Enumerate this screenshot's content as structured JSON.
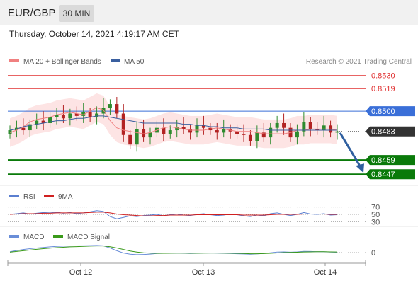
{
  "header": {
    "pair": "EUR/GBP",
    "timeframe": "30 MIN"
  },
  "datetime": "Thursday, October 14, 2021 4:19:17 AM CET",
  "legend": {
    "ma20": "MA 20 + Bollinger Bands",
    "ma50": "MA 50",
    "credit": "Research © 2021 Trading Central"
  },
  "colors": {
    "ma20": "#f08080",
    "ma50": "#3a5f9f",
    "bull": "#2e8b2e",
    "bear": "#b22222",
    "support": "#0a7a0a",
    "resistance": "#e03030",
    "pivot": "#3a6fd8",
    "current": "#333333",
    "arrow": "#2f5f9f",
    "band": "#fde4e4",
    "rsi": "#5b7fd0",
    "rsi9": "#d02020",
    "macd": "#6a8ed8",
    "macd_signal": "#3a9a1a"
  },
  "chart_data": [
    {
      "type": "line",
      "title": "EUR/GBP",
      "ylim": [
        0.844,
        0.8534
      ],
      "x_ticks": [
        "Oct 12",
        "Oct 13",
        "Oct 14"
      ],
      "levels": [
        {
          "label": "0.8530",
          "value": 0.853,
          "kind": "resistance"
        },
        {
          "label": "0.8519",
          "value": 0.8519,
          "kind": "resistance"
        },
        {
          "label": "0.8500",
          "value": 0.85,
          "kind": "pivot"
        },
        {
          "label": "0.8483",
          "value": 0.8483,
          "kind": "current"
        },
        {
          "label": "0.8459",
          "value": 0.8459,
          "kind": "support"
        },
        {
          "label": "0.8447",
          "value": 0.8447,
          "kind": "support"
        }
      ],
      "series": [
        {
          "name": "MA 20 + Bollinger Bands",
          "values": [
            0.8482,
            0.8484,
            0.8487,
            0.8491,
            0.8493,
            0.8494,
            0.8495,
            0.8497,
            0.8498,
            0.8499,
            0.8498,
            0.8497,
            0.85,
            0.8503,
            0.8501,
            0.8492,
            0.8486,
            0.8484,
            0.8483,
            0.8482,
            0.8481,
            0.8482,
            0.8484,
            0.8486,
            0.8487,
            0.8486,
            0.8485,
            0.8484,
            0.8484,
            0.8484,
            0.8485,
            0.8486,
            0.8485,
            0.8484,
            0.8483,
            0.8483,
            0.8483,
            0.8482,
            0.8481,
            0.8481,
            0.8481,
            0.8481,
            0.8482,
            0.8484,
            0.8484,
            0.8485,
            0.8485,
            0.8485,
            0.8485,
            0.8484
          ]
        },
        {
          "name": "MA 50",
          "values": [
            0.8484,
            0.8485,
            0.8487,
            0.8488,
            0.8489,
            0.849,
            0.8491,
            0.8492,
            0.8492,
            0.8493,
            0.8494,
            0.8494,
            0.8495,
            0.8496,
            0.8496,
            0.8495,
            0.8494,
            0.8493,
            0.8492,
            0.8491,
            0.849,
            0.849,
            0.849,
            0.849,
            0.849,
            0.849,
            0.8489,
            0.8489,
            0.8488,
            0.8488,
            0.8487,
            0.8487,
            0.8486,
            0.8486,
            0.8486,
            0.8485,
            0.8485,
            0.8485,
            0.8485,
            0.8484,
            0.8484,
            0.8484,
            0.8484,
            0.8484,
            0.8484,
            0.8484,
            0.8484,
            0.8484,
            0.8484,
            0.8484
          ]
        }
      ],
      "candles_close": [
        0.8484,
        0.8486,
        0.8484,
        0.8489,
        0.8492,
        0.849,
        0.8495,
        0.8497,
        0.8494,
        0.8498,
        0.8496,
        0.8499,
        0.8495,
        0.8498,
        0.8503,
        0.8506,
        0.8498,
        0.848,
        0.8472,
        0.8485,
        0.8478,
        0.8482,
        0.8486,
        0.8481,
        0.8484,
        0.8487,
        0.8485,
        0.8482,
        0.8488,
        0.8486,
        0.8484,
        0.8482,
        0.8485,
        0.8483,
        0.8481,
        0.848,
        0.8475,
        0.8482,
        0.8478,
        0.8486,
        0.849,
        0.8486,
        0.8478,
        0.8483,
        0.8491,
        0.8485,
        0.8484,
        0.8488,
        0.8482,
        0.8483
      ],
      "forecast_arrow": {
        "from": 0.8483,
        "to": 0.8447
      }
    },
    {
      "type": "line",
      "title": "RSI",
      "ylim": [
        25,
        75
      ],
      "y_ticks": [
        "70",
        "50",
        "30"
      ],
      "series": [
        {
          "name": "RSI",
          "values": [
            50,
            52,
            54,
            51,
            53,
            55,
            54,
            56,
            53,
            55,
            52,
            54,
            57,
            60,
            58,
            44,
            38,
            42,
            46,
            44,
            47,
            48,
            50,
            46,
            49,
            51,
            48,
            47,
            50,
            52,
            49,
            47,
            48,
            51,
            49,
            46,
            44,
            48,
            46,
            52,
            54,
            50,
            47,
            50,
            55,
            51,
            50,
            52,
            48,
            49
          ]
        },
        {
          "name": "9MA",
          "values": [
            50,
            51,
            52,
            52,
            52,
            53,
            53,
            54,
            54,
            54,
            54,
            54,
            55,
            56,
            56,
            54,
            51,
            49,
            48,
            47,
            46,
            46,
            47,
            47,
            48,
            48,
            48,
            48,
            49,
            49,
            49,
            49,
            49,
            49,
            49,
            48,
            48,
            48,
            48,
            49,
            50,
            50,
            50,
            50,
            51,
            51,
            51,
            51,
            50,
            50
          ]
        }
      ]
    },
    {
      "type": "line",
      "title": "MACD",
      "ylim": [
        -1,
        1
      ],
      "y_ticks": [
        "0"
      ],
      "series": [
        {
          "name": "MACD",
          "values": [
            0.1,
            0.22,
            0.34,
            0.42,
            0.5,
            0.56,
            0.62,
            0.68,
            0.7,
            0.72,
            0.73,
            0.74,
            0.76,
            0.78,
            0.74,
            0.5,
            0.2,
            -0.05,
            -0.18,
            -0.22,
            -0.2,
            -0.16,
            -0.1,
            -0.08,
            -0.06,
            -0.05,
            -0.07,
            -0.1,
            -0.08,
            -0.05,
            -0.04,
            -0.06,
            -0.08,
            -0.1,
            -0.12,
            -0.15,
            -0.18,
            -0.14,
            -0.1,
            -0.02,
            0.06,
            0.08,
            0.05,
            0.08,
            0.14,
            0.12,
            0.1,
            0.1,
            0.06,
            0.04
          ]
        },
        {
          "name": "MACD Signal",
          "values": [
            0.05,
            0.12,
            0.2,
            0.28,
            0.35,
            0.42,
            0.48,
            0.54,
            0.58,
            0.62,
            0.65,
            0.68,
            0.7,
            0.72,
            0.72,
            0.64,
            0.5,
            0.34,
            0.18,
            0.06,
            -0.02,
            -0.06,
            -0.08,
            -0.08,
            -0.07,
            -0.06,
            -0.06,
            -0.07,
            -0.07,
            -0.06,
            -0.05,
            -0.05,
            -0.06,
            -0.07,
            -0.08,
            -0.1,
            -0.12,
            -0.12,
            -0.11,
            -0.08,
            -0.04,
            0.0,
            0.02,
            0.04,
            0.07,
            0.08,
            0.09,
            0.09,
            0.08,
            0.07
          ]
        }
      ]
    }
  ]
}
